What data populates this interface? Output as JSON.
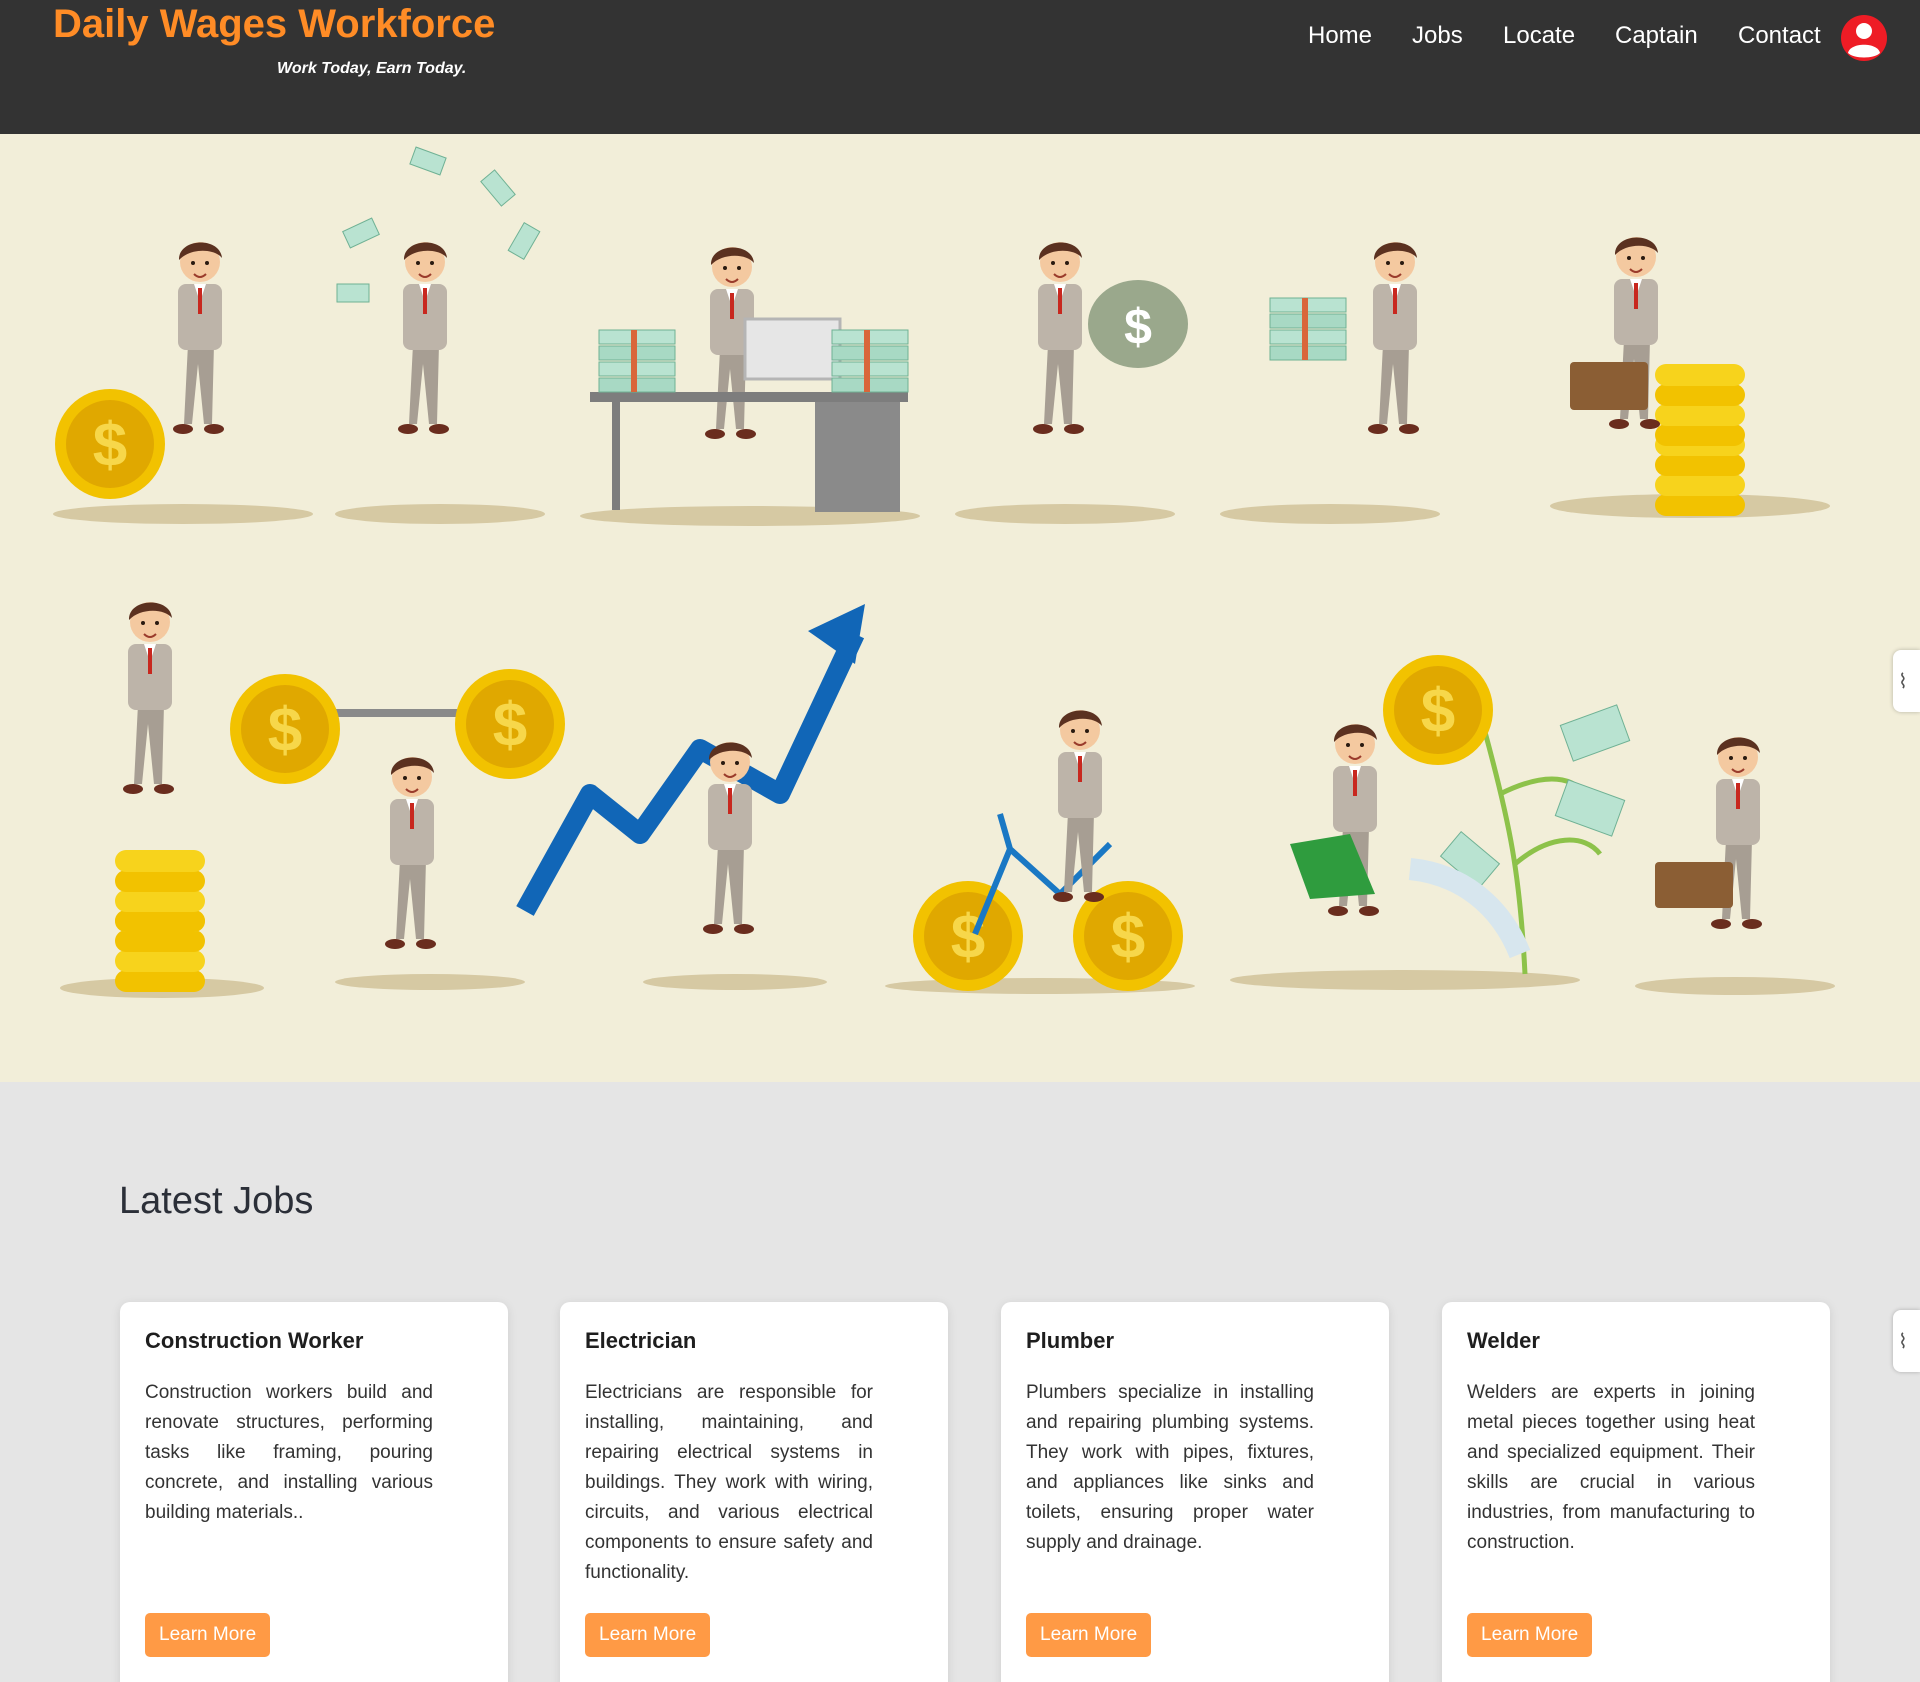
{
  "brand": {
    "title": "Daily Wages Workforce",
    "tagline": "Work Today, Earn Today."
  },
  "nav": {
    "items": [
      {
        "label": "Home"
      },
      {
        "label": "Jobs"
      },
      {
        "label": "Locate"
      },
      {
        "label": "Captain"
      },
      {
        "label": "Contact"
      }
    ],
    "profile_icon": "user-profile-icon"
  },
  "hero": {
    "illustration": "businessman-money-illustration",
    "background_color": "#f2eed9"
  },
  "jobs": {
    "heading": "Latest Jobs",
    "cards": [
      {
        "title": "Construction Worker",
        "description": "Construction workers build and renovate structures, performing tasks like framing, pouring concrete, and installing various building materials..",
        "button": "Learn More"
      },
      {
        "title": "Electrician",
        "description": "Electricians are responsible for installing, maintaining, and repairing electrical systems in buildings. They work with wiring, circuits, and various electrical components to ensure safety and functionality.",
        "button": "Learn More"
      },
      {
        "title": "Plumber",
        "description": "Plumbers specialize in installing and repairing plumbing systems. They work with pipes, fixtures, and appliances like sinks and toilets, ensuring proper water supply and drainage.",
        "button": "Learn More"
      },
      {
        "title": "Welder",
        "description": "Welders are experts in joining metal pieces together using heat and specialized equipment. Their skills are crucial in various industries, from manufacturing to construction.",
        "button": "Learn More"
      }
    ]
  },
  "colors": {
    "header_bg": "#333333",
    "brand_orange": "#ff8c26",
    "button_orange": "#ff9a45",
    "avatar_red": "#ee1c25",
    "page_bg": "#e5e5e5"
  }
}
